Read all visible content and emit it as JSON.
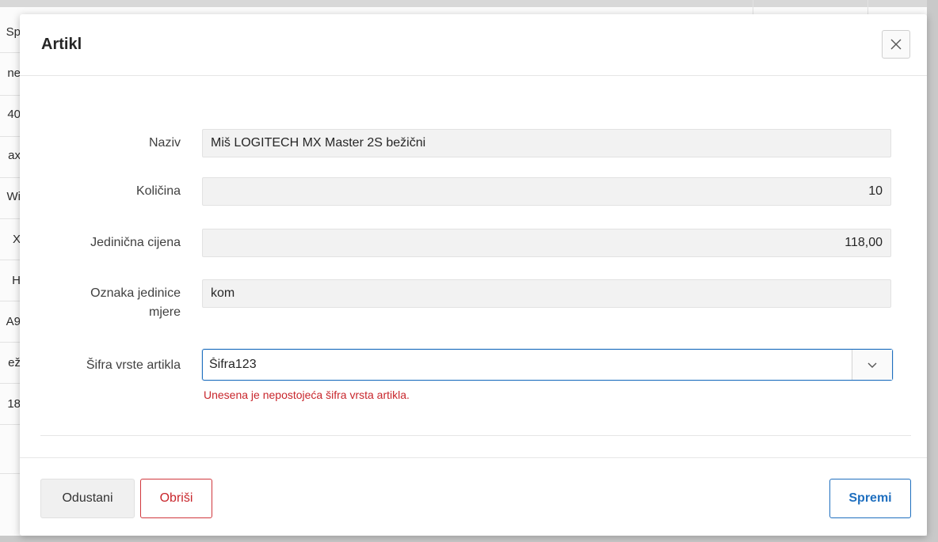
{
  "background": {
    "cells": [
      "Sp",
      "ne",
      "40",
      "ax",
      "Wi",
      "X",
      "H",
      "A9",
      "ež",
      "18"
    ]
  },
  "dialog": {
    "title": "Artikl",
    "close_icon": "close-icon",
    "fields": {
      "naziv": {
        "label": "Naziv",
        "value": "Miš LOGITECH MX Master 2S bežični"
      },
      "kolicina": {
        "label": "Količina",
        "value": "10"
      },
      "cijena": {
        "label": "Jedinična cijena",
        "value": "118,00"
      },
      "jedinica": {
        "label_line1": "Oznaka jedinice",
        "label_line2": "mjere",
        "value": "kom"
      },
      "sifra": {
        "label": "Šifra vrste artikla",
        "value": "Šifra123",
        "dropdown_icon": "chevron-down-icon"
      }
    },
    "error": "Unesena je nepostojeća šifra vrsta artikla.",
    "footer": {
      "cancel_label": "Odustani",
      "delete_label": "Obriši",
      "save_label": "Spremi"
    }
  },
  "colors": {
    "accent": "#1f6fbf",
    "error": "#c8262c"
  }
}
